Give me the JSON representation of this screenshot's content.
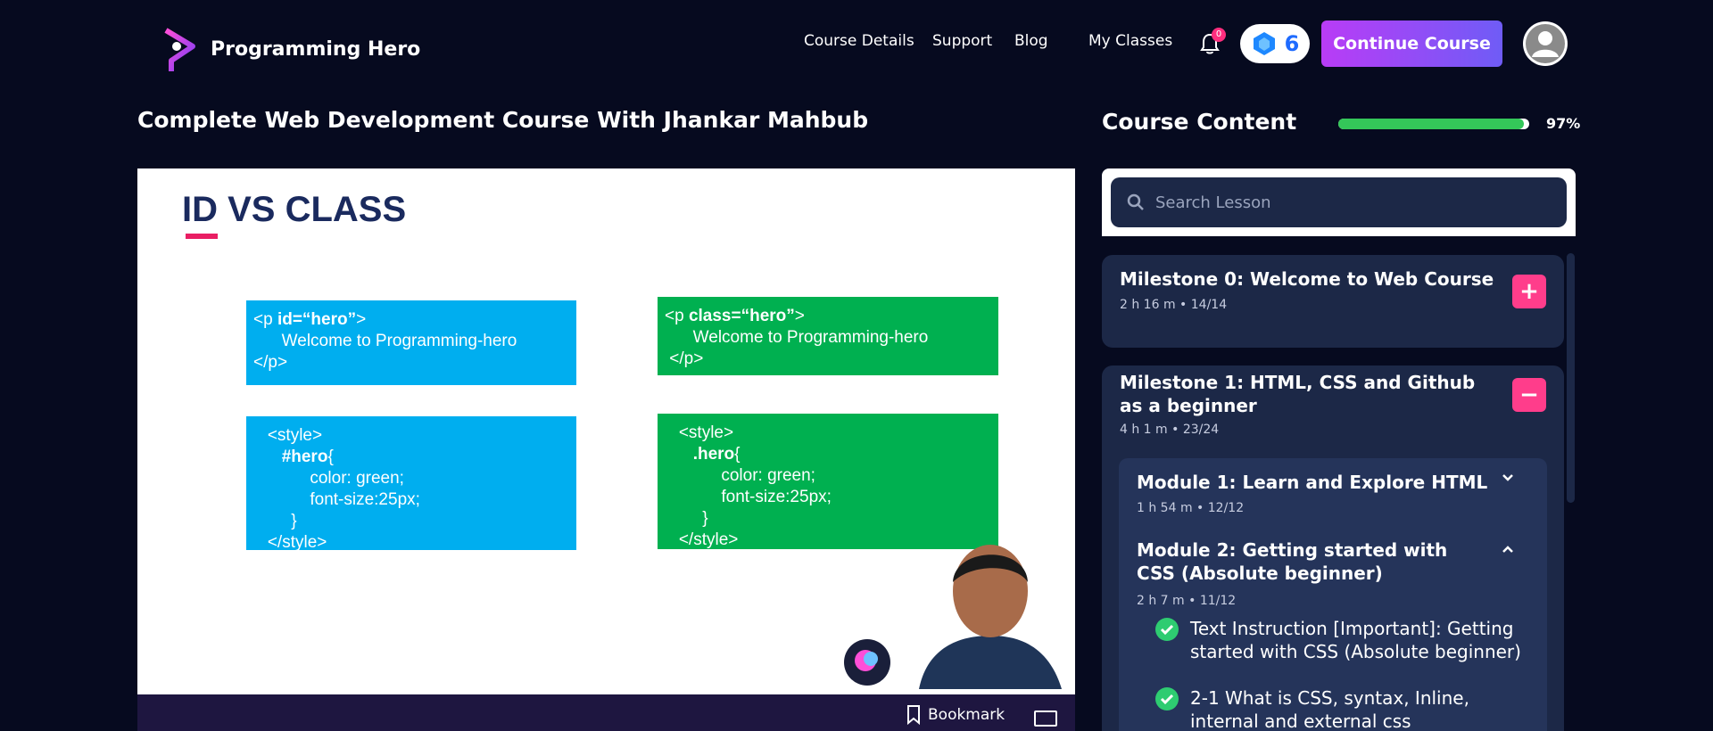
{
  "brand": {
    "name": "Programming Hero"
  },
  "nav": {
    "course_details": "Course Details",
    "support": "Support",
    "blog": "Blog",
    "my_classes": "My Classes"
  },
  "notifications": {
    "count": "0"
  },
  "gems": {
    "count": "6"
  },
  "header": {
    "continue_label": "Continue Course"
  },
  "course": {
    "title": "Complete Web Development Course With Jhankar Mahbub"
  },
  "slide": {
    "title": "ID VS CLASS",
    "id_html": {
      "line1_pre": "<p ",
      "line1_attr": "id=“hero”",
      "line1_post": ">",
      "line2": "      Welcome to Programming-hero",
      "line3": "</p>"
    },
    "class_html": {
      "line1_pre": "<p ",
      "line1_attr": "class=“hero”",
      "line1_post": ">",
      "line2": "      Welcome to Programming-hero",
      "line3": " </p>"
    },
    "id_css": {
      "line1": "   <style>",
      "selector": "#hero",
      "brace": "{",
      "line3": "            color: green;",
      "line4": "            font-size:25px;",
      "line5": "        }",
      "line6": "   </style>"
    },
    "class_css": {
      "line1": "   <style>",
      "selector": ".hero",
      "brace": "{",
      "line3": "            color: green;",
      "line4": "            font-size:25px;",
      "line5": "        }",
      "line6": "   </style>"
    }
  },
  "video_controls": {
    "bookmark": "Bookmark"
  },
  "sidebar": {
    "heading": "Course Content",
    "progress_percent": 97,
    "progress_label": "97%",
    "search_placeholder": "Search Lesson",
    "milestones": [
      {
        "title": "Milestone 0: Welcome to Web Course",
        "duration": "2 h 16 m",
        "progress": "14/14",
        "toggle": "+"
      },
      {
        "title": "Milestone 1: HTML, CSS and Github as a beginner",
        "duration": "4 h 1 m",
        "progress": "23/24",
        "toggle": "−"
      }
    ],
    "modules": [
      {
        "title": "Module 1: Learn and Explore HTML",
        "duration": "1 h 54 m",
        "progress": "12/12"
      },
      {
        "title": "Module 2: Getting started with CSS (Absolute beginner)",
        "duration": "2 h 7 m",
        "progress": "11/12"
      }
    ],
    "lessons": [
      {
        "title": "Text Instruction [Important]: Getting started with CSS (Absolute beginner)"
      },
      {
        "title": "2-1 What is CSS, syntax, Inline, internal and external css"
      }
    ]
  },
  "colors": {
    "accent_pink": "#ff3d8b",
    "progress_green": "#34c759",
    "button_gradient_start": "#b93cf6",
    "button_gradient_end": "#6f5cf6"
  }
}
